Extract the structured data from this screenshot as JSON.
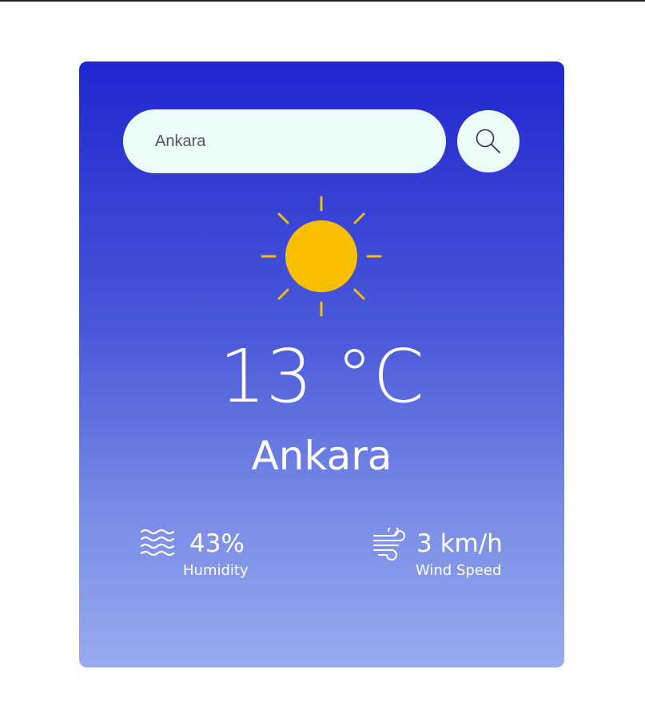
{
  "search": {
    "value": "Ankara",
    "icon": "search-icon"
  },
  "weather": {
    "condition_icon": "sun-icon",
    "temperature": "13 °C",
    "city": "Ankara"
  },
  "humidity": {
    "icon": "humidity-icon",
    "value": "43%",
    "label": "Humidity"
  },
  "wind": {
    "icon": "wind-icon",
    "value": "3 km/h",
    "label": "Wind Speed"
  },
  "colors": {
    "card_top": "#2026cf",
    "card_bottom": "#99aaef",
    "input_bg": "#ecfcf9",
    "sun": "#f8bf00",
    "text": "#ffffff"
  }
}
